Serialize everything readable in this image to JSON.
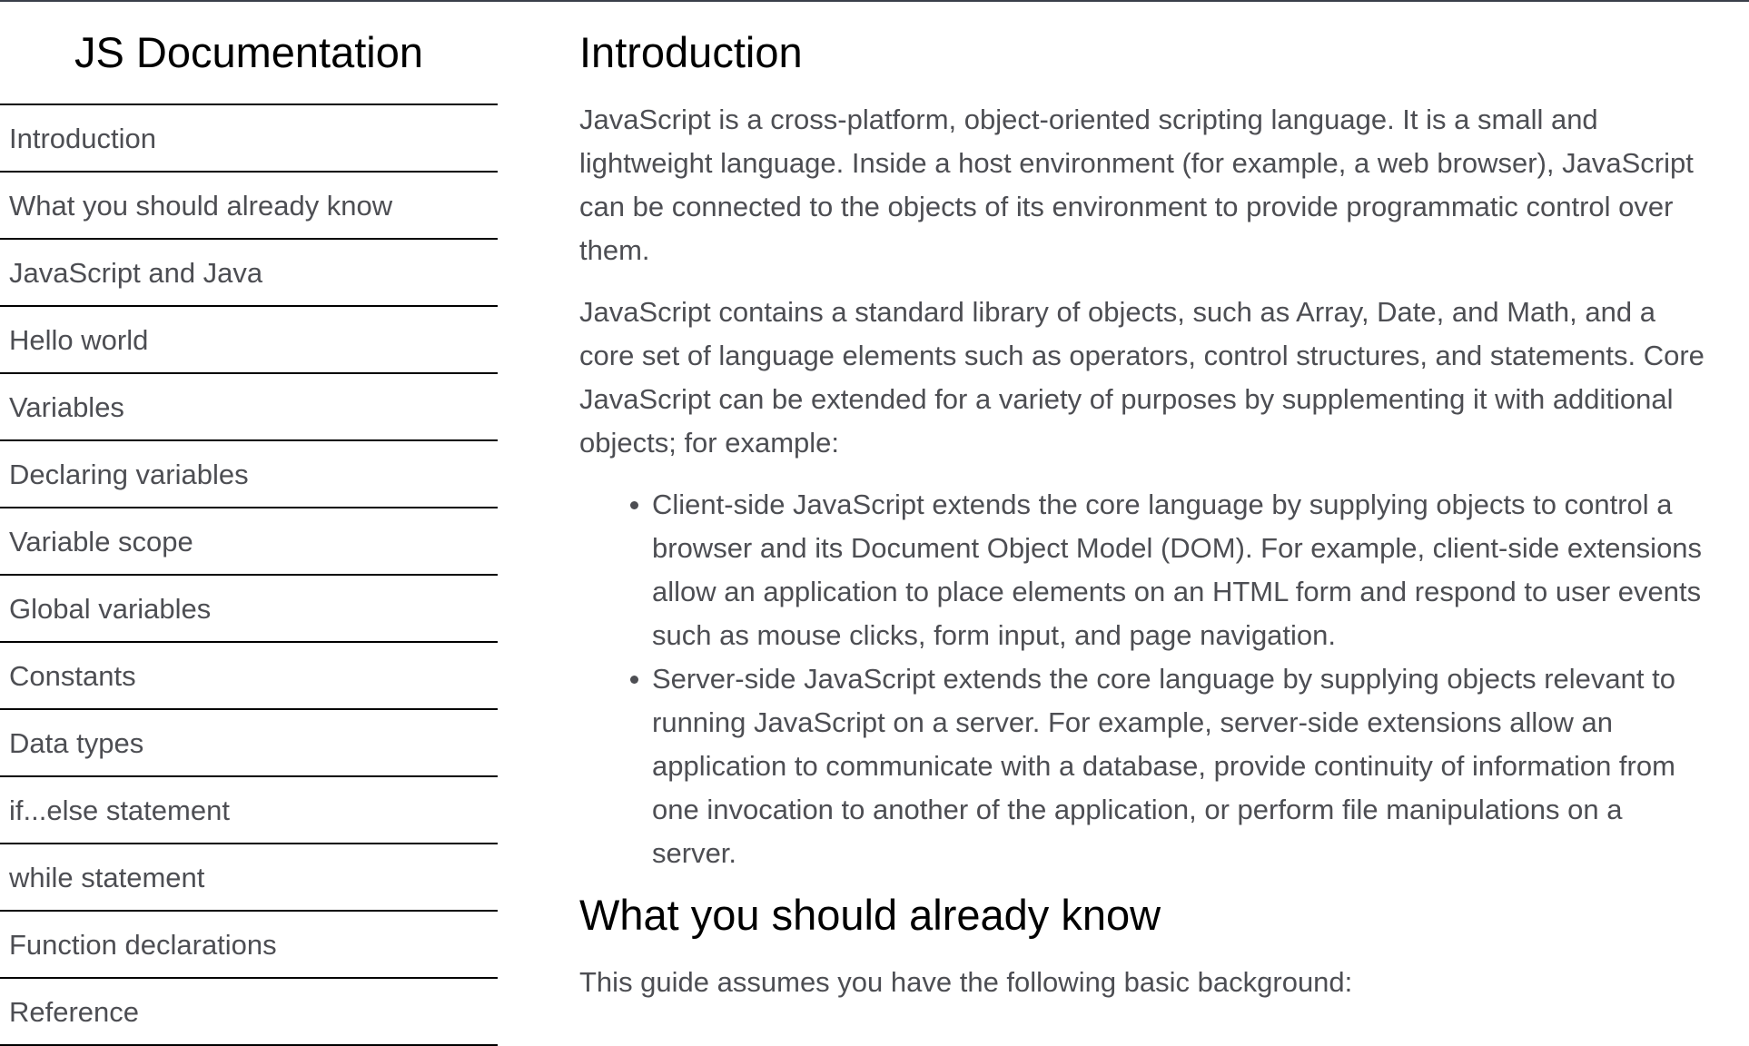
{
  "sidebar": {
    "title": "JS Documentation",
    "items": [
      {
        "label": "Introduction"
      },
      {
        "label": "What you should already know"
      },
      {
        "label": "JavaScript and Java"
      },
      {
        "label": "Hello world"
      },
      {
        "label": "Variables"
      },
      {
        "label": "Declaring variables"
      },
      {
        "label": "Variable scope"
      },
      {
        "label": "Global variables"
      },
      {
        "label": "Constants"
      },
      {
        "label": "Data types"
      },
      {
        "label": "if...else statement"
      },
      {
        "label": "while statement"
      },
      {
        "label": "Function declarations"
      },
      {
        "label": "Reference"
      }
    ]
  },
  "main": {
    "intro": {
      "title": "Introduction",
      "paragraph1": "JavaScript is a cross-platform, object-oriented scripting language. It is a small and lightweight language. Inside a host environment (for example, a web browser), JavaScript can be connected to the objects of its environment to provide programmatic control over them.",
      "paragraph2": "JavaScript contains a standard library of objects, such as Array, Date, and Math, and a core set of language elements such as operators, control structures, and statements. Core JavaScript can be extended for a variety of purposes by supplementing it with additional objects; for example:",
      "bullets": [
        "Client-side JavaScript extends the core language by supplying objects to control a browser and its Document Object Model (DOM). For example, client-side extensions allow an application to place elements on an HTML form and respond to user events such as mouse clicks, form input, and page navigation.",
        "Server-side JavaScript extends the core language by supplying objects relevant to running JavaScript on a server. For example, server-side extensions allow an application to communicate with a database, provide continuity of information from one invocation to another of the application, or perform file manipulations on a server."
      ]
    },
    "know": {
      "title": "What you should already know",
      "paragraph1": "This guide assumes you have the following basic background:"
    }
  }
}
